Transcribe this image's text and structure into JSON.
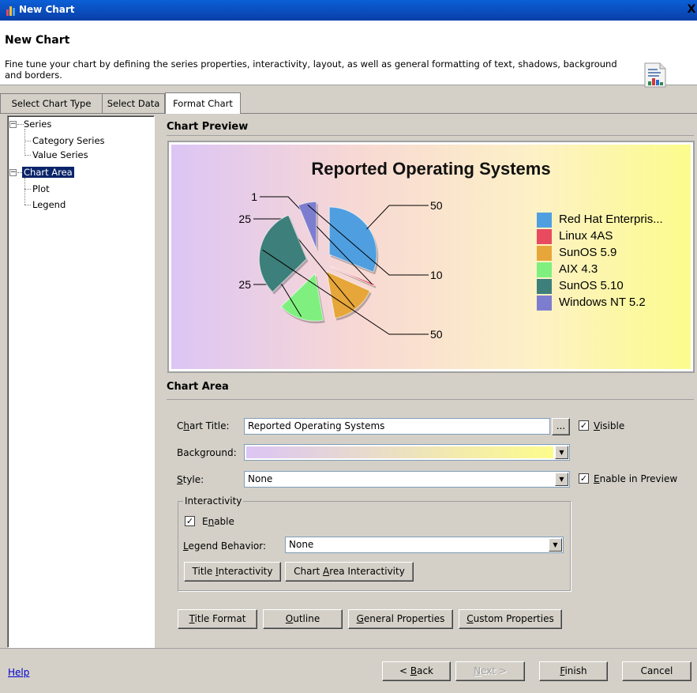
{
  "window": {
    "title": "New Chart",
    "close_glyph": "X"
  },
  "header": {
    "title": "New Chart",
    "description": "Fine tune your chart by defining the series properties, interactivity, layout, as well as general formatting of text, shadows, background and borders."
  },
  "tabs": [
    {
      "label": "Select Chart Type"
    },
    {
      "label": "Select Data"
    },
    {
      "label": "Format Chart"
    }
  ],
  "tree": {
    "toggle_glyph": "−",
    "series": "Series",
    "category_series": "Category Series",
    "value_series": "Value Series",
    "chart_area": "Chart Area",
    "plot": "Plot",
    "legend": "Legend"
  },
  "preview": {
    "section_title": "Chart Preview"
  },
  "chart_data": {
    "type": "pie",
    "title": "Reported Operating Systems",
    "categories": [
      "Red Hat Enterpris...",
      "Linux 4AS",
      "SunOS 5.9",
      "AIX 4.3",
      "SunOS 5.10",
      "Windows NT 5.2"
    ],
    "values": [
      50,
      1,
      25,
      25,
      50,
      10
    ],
    "colors": [
      "#4f9fe0",
      "#e84a5f",
      "#e6a63a",
      "#7ff07f",
      "#3d7f7a",
      "#7d7dd0"
    ],
    "exploded": true,
    "legend_position": "right",
    "background": "gradient purple-to-yellow"
  },
  "chart_area": {
    "section_title": "Chart Area",
    "chart_title_label_pre": "C",
    "chart_title_label_u": "h",
    "chart_title_label_post": "art Title:",
    "chart_title_value": "Reported Operating Systems",
    "ellipsis": "...",
    "visible_label_u": "V",
    "visible_label_post": "isible",
    "background_label": "Background:",
    "style_label_u": "S",
    "style_label_post": "tyle:",
    "style_value": "None",
    "enable_preview_label_u": "E",
    "enable_preview_label_post": "nable in Preview",
    "check_glyph": "✓",
    "dropdown_glyph": "▼"
  },
  "interactivity": {
    "group_label": "Interactivity",
    "enable_label_pre": "E",
    "enable_label_u": "n",
    "enable_label_post": "able",
    "legend_behavior_label_u": "L",
    "legend_behavior_label_post": "egend Behavior:",
    "legend_behavior_value": "None",
    "title_interactivity_pre": "Title ",
    "title_interactivity_u": "I",
    "title_interactivity_post": "nteractivity",
    "chart_area_interactivity_pre": "Chart ",
    "chart_area_interactivity_u": "A",
    "chart_area_interactivity_post": "rea Interactivity"
  },
  "format_buttons": {
    "title_format_u": "T",
    "title_format_post": "itle Format",
    "outline_u": "O",
    "outline_post": "utline",
    "general_u": "G",
    "general_post": "eneral Properties",
    "custom_u": "C",
    "custom_post": "ustom Properties"
  },
  "footer": {
    "help": "Help",
    "back_pre": "< ",
    "back_u": "B",
    "back_post": "ack",
    "next_u": "N",
    "next_post": "ext >",
    "finish_u": "F",
    "finish_post": "inish",
    "cancel": "Cancel"
  }
}
